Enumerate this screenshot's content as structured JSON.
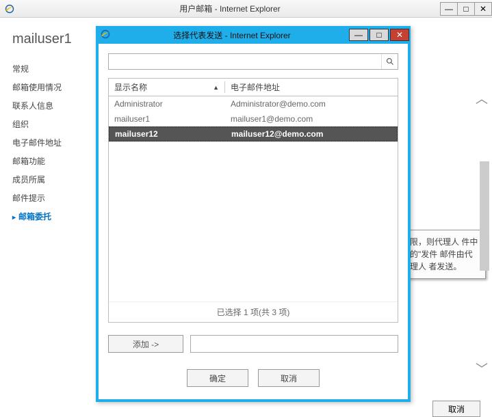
{
  "parentWindow": {
    "title": "用户邮箱 - Internet Explorer",
    "minimize": "—",
    "maximize": "□",
    "close": "✕"
  },
  "background": {
    "pageTitle": "mailuser1",
    "nav": {
      "item0": "常规",
      "item1": "邮箱使用情况",
      "item2": "联系人信息",
      "item3": "组织",
      "item4": "电子邮件地址",
      "item5": "邮箱功能",
      "item6": "成员所属",
      "item7": "邮件提示",
      "item8": "邮箱委托"
    },
    "hintText": "限，则代理人\n件中的\"发件\n邮件由代理人\n者发送。",
    "cancelLabel": "取消",
    "scrollUp": "︿",
    "scrollDown": "﹀"
  },
  "dialog": {
    "title": "选择代表发送 - Internet Explorer",
    "minimize": "—",
    "maximize": "□",
    "close": "✕",
    "searchPlaceholder": "",
    "headers": {
      "name": "显示名称",
      "email": "电子邮件地址"
    },
    "sortGlyph": "▲",
    "rows": [
      {
        "name": "Administrator",
        "email": "Administrator@demo.com",
        "selected": false
      },
      {
        "name": "mailuser1",
        "email": "mailuser1@demo.com",
        "selected": false
      },
      {
        "name": "mailuser12",
        "email": "mailuser12@demo.com",
        "selected": true
      }
    ],
    "footer": "已选择 1 项(共 3 项)",
    "addButton": "添加 ->",
    "ok": "确定",
    "cancel": "取消"
  }
}
